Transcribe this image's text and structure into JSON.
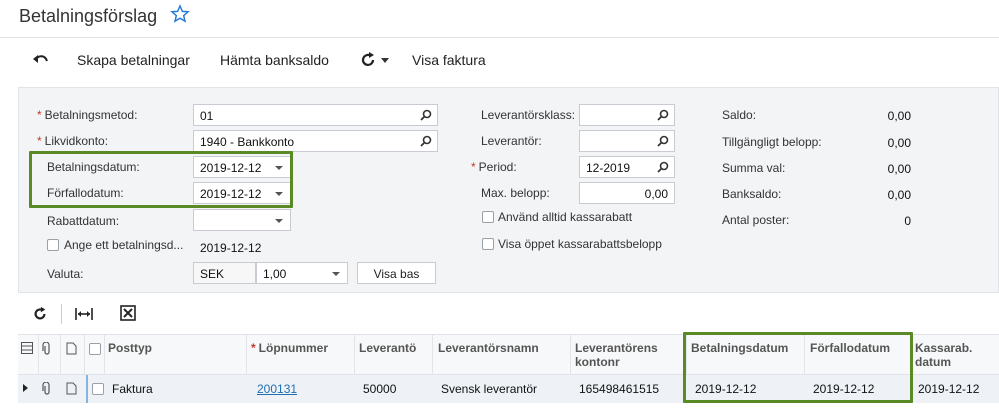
{
  "page": {
    "title": "Betalningsförslag"
  },
  "toolbar": {
    "skapa_label": "Skapa betalningar",
    "hamta_label": "Hämta banksaldo",
    "visa_faktura_label": "Visa faktura"
  },
  "form": {
    "betalningsmetod": {
      "label": "Betalningsmetod:",
      "value": "01"
    },
    "likvidkonto": {
      "label": "Likvidkonto:",
      "value": "1940 - Bankkonto"
    },
    "betalningsdatum": {
      "label": "Betalningsdatum:",
      "value": "2019-12-12"
    },
    "forfallodatum": {
      "label": "Förfallodatum:",
      "value": "2019-12-12"
    },
    "rabattdatum": {
      "label": "Rabattdatum:",
      "value": ""
    },
    "ange_betalningsdatum": {
      "label": "Ange ett betalningsd...",
      "value": "2019-12-12"
    },
    "valuta": {
      "label": "Valuta:",
      "currency": "SEK",
      "rate": "1,00",
      "button": "Visa bas"
    },
    "leverantorsklass": {
      "label": "Leverantörsklass:",
      "value": ""
    },
    "leverantor": {
      "label": "Leverantör:",
      "value": ""
    },
    "period": {
      "label": "Period:",
      "value": "12-2019"
    },
    "max_belopp": {
      "label": "Max. belopp:",
      "value": "0,00"
    },
    "anvand_kassarabatt": {
      "label": "Använd alltid kassarabatt"
    },
    "visa_oppet": {
      "label": "Visa öppet kassarabattsbelopp"
    },
    "summary": [
      {
        "label": "Saldo:",
        "value": "0,00"
      },
      {
        "label": "Tillgängligt belopp:",
        "value": "0,00"
      },
      {
        "label": "Summa val:",
        "value": "0,00"
      },
      {
        "label": "Banksaldo:",
        "value": "0,00"
      },
      {
        "label": "Antal poster:",
        "value": "0"
      }
    ]
  },
  "grid": {
    "columns": {
      "posttyp": "Posttyp",
      "lopnummer": "Löpnummer",
      "leverantor": "Leverantö",
      "leverantorsnamn": "Leverantörsnamn",
      "kontonr_1": "Leverantörens",
      "kontonr_2": "kontonr",
      "betalningsdatum": "Betalningsdatum",
      "forfallodatum": "Förfallodatum",
      "kassarab_1": "Kassarab.",
      "kassarab_2": "datum"
    },
    "rows": [
      {
        "posttyp": "Faktura",
        "lopnummer": "200131",
        "leverantor": "50000",
        "leverantorsnamn": "Svensk leverantör",
        "kontonr": "165498461515",
        "betalningsdatum": "2019-12-12",
        "forfallodatum": "2019-12-12",
        "kassarab": "2019-12-12"
      }
    ]
  },
  "colors": {
    "highlight_border": "#5a8a25",
    "link": "#1f6fb2",
    "star": "#2a7bd6"
  }
}
